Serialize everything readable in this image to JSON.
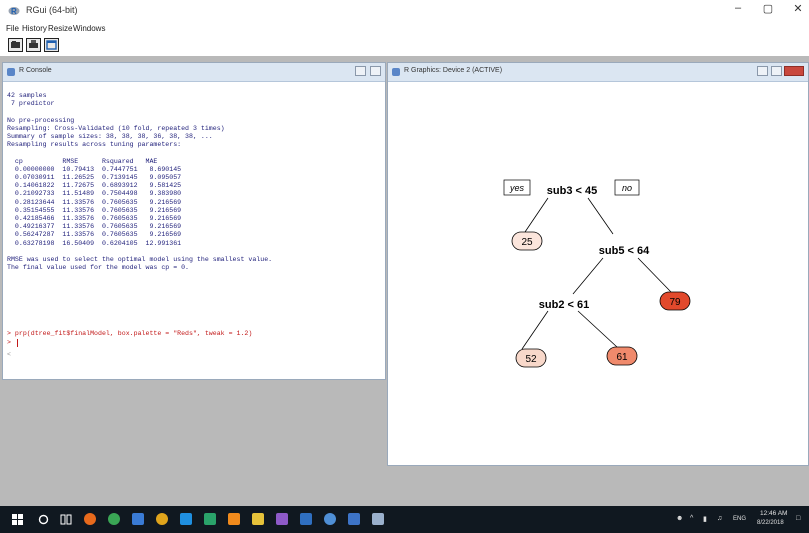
{
  "app": {
    "title": "RGui (64-bit)"
  },
  "window_controls": {
    "minimize": "–",
    "restore": "▢",
    "close": "✕"
  },
  "menu": [
    "File",
    "History",
    "Resize",
    "Windows"
  ],
  "toolbar": [
    "open-script-button",
    "print-button",
    "toggle-console-button"
  ],
  "console": {
    "title": "R Console",
    "lines": [
      "42 samples",
      " 7 predictor",
      "",
      "No pre-processing",
      "Resampling: Cross-Validated (10 fold, repeated 3 times)",
      "Summary of sample sizes: 38, 38, 38, 36, 38, 38, ...",
      "Resampling results across tuning parameters:",
      "",
      "  cp          RMSE      Rsquared   MAE",
      "  0.00000000  10.79413  0.7447751   8.690145",
      "  0.07030911  11.26525  0.7139145   9.095057",
      "  0.14061822  11.72675  0.6893912   9.581425",
      "  0.21092733  11.51489  0.7504498   9.383980",
      "  0.28123644  11.33576  0.7605635   9.216569",
      "  0.35154555  11.33576  0.7605635   9.216569",
      "  0.42185466  11.33576  0.7605635   9.216569",
      "  0.49216377  11.33576  0.7605635   9.216569",
      "  0.56247287  11.33576  0.7605635   9.216569",
      "  0.63278198  16.50409  0.6204105  12.991361",
      "",
      "RMSE was used to select the optimal model using the smallest value.",
      "The final value used for the model was cp = 0."
    ],
    "command": "> prp(dtree_fit$finalModel, box.palette = \"Reds\", tweak = 1.2)",
    "prompt": ">",
    "scroll_marker": "<"
  },
  "graphics": {
    "title": "R Graphics: Device 2 (ACTIVE)",
    "tree": {
      "yes_label": "yes",
      "no_label": "no",
      "splits": [
        "sub3 < 45",
        "sub5 < 64",
        "sub2 < 61"
      ],
      "leaves": [
        {
          "value": "25",
          "color": "#fbe5dc"
        },
        {
          "value": "79",
          "color": "#e2492c"
        },
        {
          "value": "52",
          "color": "#f8d8ca"
        },
        {
          "value": "61",
          "color": "#f08a6c"
        }
      ]
    }
  },
  "tray": {
    "language": "ENG",
    "time": "12:46 AM",
    "date": "8/22/2018"
  }
}
